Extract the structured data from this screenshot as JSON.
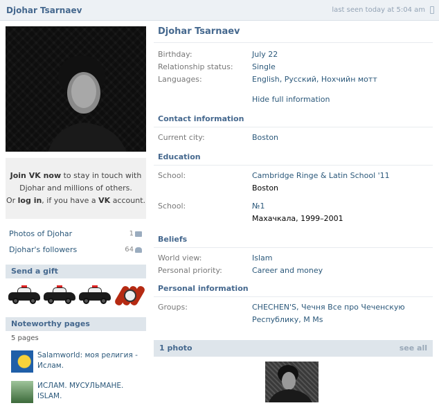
{
  "topbar": {
    "name": "Djohar Tsarnaev",
    "last_seen": "last seen today at 5:04 am",
    "device_icon": "phone-icon"
  },
  "join": {
    "line1_bold": "Join VK now",
    "line1_rest": " to stay in touch with",
    "line2": "Djohar and millions of others.",
    "line3_pre": "Or ",
    "line3_login": "log in",
    "line3_mid": ", if you have a ",
    "line3_vk": "VK",
    "line3_post": " account."
  },
  "links": {
    "photos_label": "Photos of Djohar",
    "photos_count": "1",
    "followers_label": "Djohar's followers",
    "followers_count": "64"
  },
  "gift": {
    "header": "Send a gift"
  },
  "noteworthy": {
    "header": "Noteworthy pages",
    "count": "5 pages",
    "items": [
      {
        "line1": "Salamworld: моя религия -",
        "line2": "Ислам."
      },
      {
        "line1": "ИСЛАМ. МУСУЛЬМАНЕ.",
        "line2": "ISLAM."
      }
    ]
  },
  "profile": {
    "name": "Djohar Tsarnaev",
    "birthday_label": "Birthday:",
    "birthday": "July 22",
    "relationship_label": "Relationship status:",
    "relationship": "Single",
    "languages_label": "Languages:",
    "languages": "English, Русский, Нохчийн мотт",
    "hide_link": "Hide full information"
  },
  "contact": {
    "header": "Contact information",
    "city_label": "Current city:",
    "city": "Boston"
  },
  "education": {
    "header": "Education",
    "school1_label": "School:",
    "school1": "Cambridge Ringe & Latin School '11",
    "school1_city": "Boston",
    "school2_label": "School:",
    "school2": "№1",
    "school2_city": "Махачкала, 1999–2001"
  },
  "beliefs": {
    "header": "Beliefs",
    "world_label": "World view:",
    "world": "Islam",
    "priority_label": "Personal priority:",
    "priority": "Career and money"
  },
  "personal": {
    "header": "Personal information",
    "groups_label": "Groups:",
    "groups_line1": "CHECHEN'S, Чечня Все про Чеченскую",
    "groups_line2": "Республику, M Ms"
  },
  "photos": {
    "header": "1 photo",
    "see_all": "see all"
  }
}
